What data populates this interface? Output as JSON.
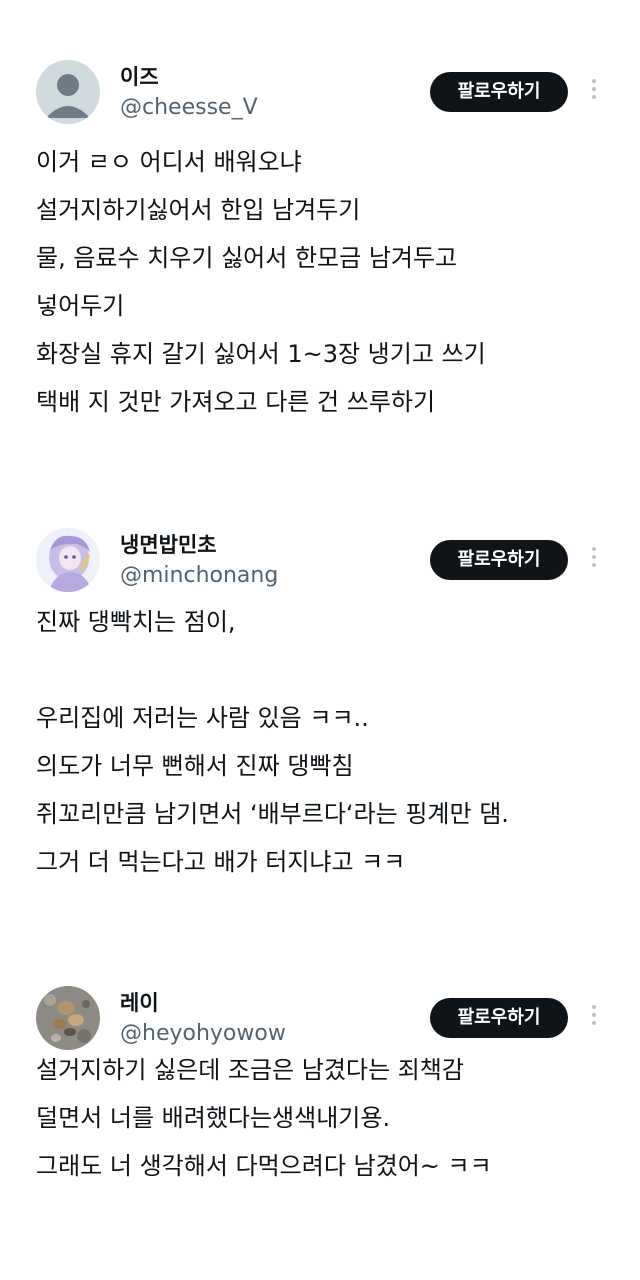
{
  "posts": [
    {
      "display_name": "이즈",
      "handle": "@cheesse_V",
      "follow_label": "팔로우하기",
      "avatar_icon": "default-person-avatar",
      "lines": [
        "이거 ㄹㅇ 어디서 배워오냐",
        "설거지하기싫어서 한입 남겨두기",
        "물, 음료수 치우기 싫어서 한모금 남겨두고",
        "넣어두기",
        "화장실 휴지 갈기 싫어서 1~3장 냉기고 쓰기",
        "택배 지 것만 가져오고 다른 건 쓰루하기"
      ]
    },
    {
      "display_name": "냉면밥민초",
      "handle": "@minchonang",
      "follow_label": "팔로우하기",
      "avatar_icon": "anime-character-avatar",
      "lines": [
        "진짜 댕빡치는 점이,",
        "",
        "우리집에 저러는 사람 있음 ㅋㅋ..",
        "의도가 너무 뻔해서 진짜 댕빡침",
        "쥐꼬리만큼 남기면서 ‘배부르다‘라는 핑계만 댐.",
        "그거 더 먹는다고 배가 터지냐고 ㅋㅋ"
      ]
    },
    {
      "display_name": "레이",
      "handle": "@heyohyowow",
      "follow_label": "팔로우하기",
      "avatar_icon": "pebbles-photo-avatar",
      "lines": [
        "설거지하기 싫은데 조금은 남겼다는 죄책감",
        "덜면서 너를 배려했다는생색내기용.",
        "그래도 너 생각해서 다먹으려다 남겼어~ ㅋㅋ"
      ]
    }
  ],
  "more_icon": "more-vertical-icon"
}
